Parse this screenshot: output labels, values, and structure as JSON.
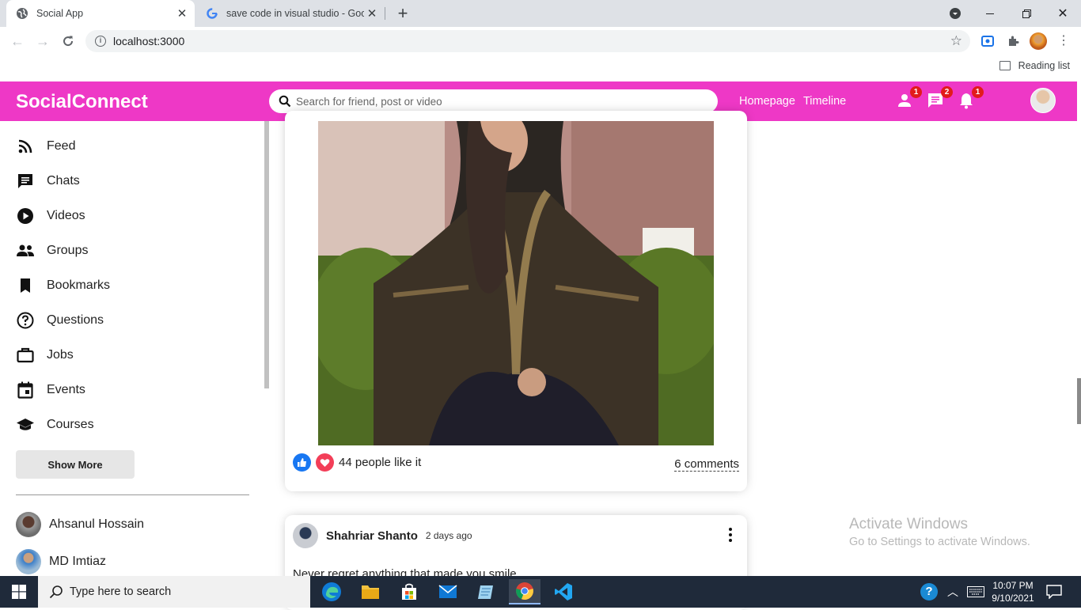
{
  "browser": {
    "tabs": [
      {
        "title": "Social App",
        "active": true
      },
      {
        "title": "save code in visual studio - Goog",
        "active": false
      }
    ],
    "url": "localhost:3000",
    "reading_list": "Reading list"
  },
  "app": {
    "logo": "SocialConnect",
    "search_placeholder": "Search for friend, post or video",
    "nav_links": [
      "Homepage",
      "Timeline"
    ],
    "badges": {
      "friends": "1",
      "chats": "2",
      "notifications": "1"
    },
    "accent_color": "#ee38c6"
  },
  "sidebar": {
    "items": [
      {
        "label": "Feed",
        "icon": "rss-feed-icon"
      },
      {
        "label": "Chats",
        "icon": "chat-icon"
      },
      {
        "label": "Videos",
        "icon": "play-circle-icon"
      },
      {
        "label": "Groups",
        "icon": "group-icon"
      },
      {
        "label": "Bookmarks",
        "icon": "bookmark-icon"
      },
      {
        "label": "Questions",
        "icon": "help-circle-icon"
      },
      {
        "label": "Jobs",
        "icon": "briefcase-icon"
      },
      {
        "label": "Events",
        "icon": "calendar-icon"
      },
      {
        "label": "Courses",
        "icon": "school-icon"
      }
    ],
    "show_more": "Show More",
    "friends": [
      {
        "name": "Ahsanul Hossain"
      },
      {
        "name": "MD Imtiaz"
      }
    ]
  },
  "feed": {
    "post1": {
      "likes_text": "44 people like it",
      "comments_text": "6 comments"
    },
    "post2": {
      "author": "Shahriar Shanto",
      "time": "2 days ago",
      "text": "Never regret anything that made you smile"
    }
  },
  "watermark": {
    "line1": "Activate Windows",
    "line2": "Go to Settings to activate Windows."
  },
  "taskbar": {
    "search_placeholder": "Type here to search",
    "time": "10:07 PM",
    "date": "9/10/2021"
  }
}
